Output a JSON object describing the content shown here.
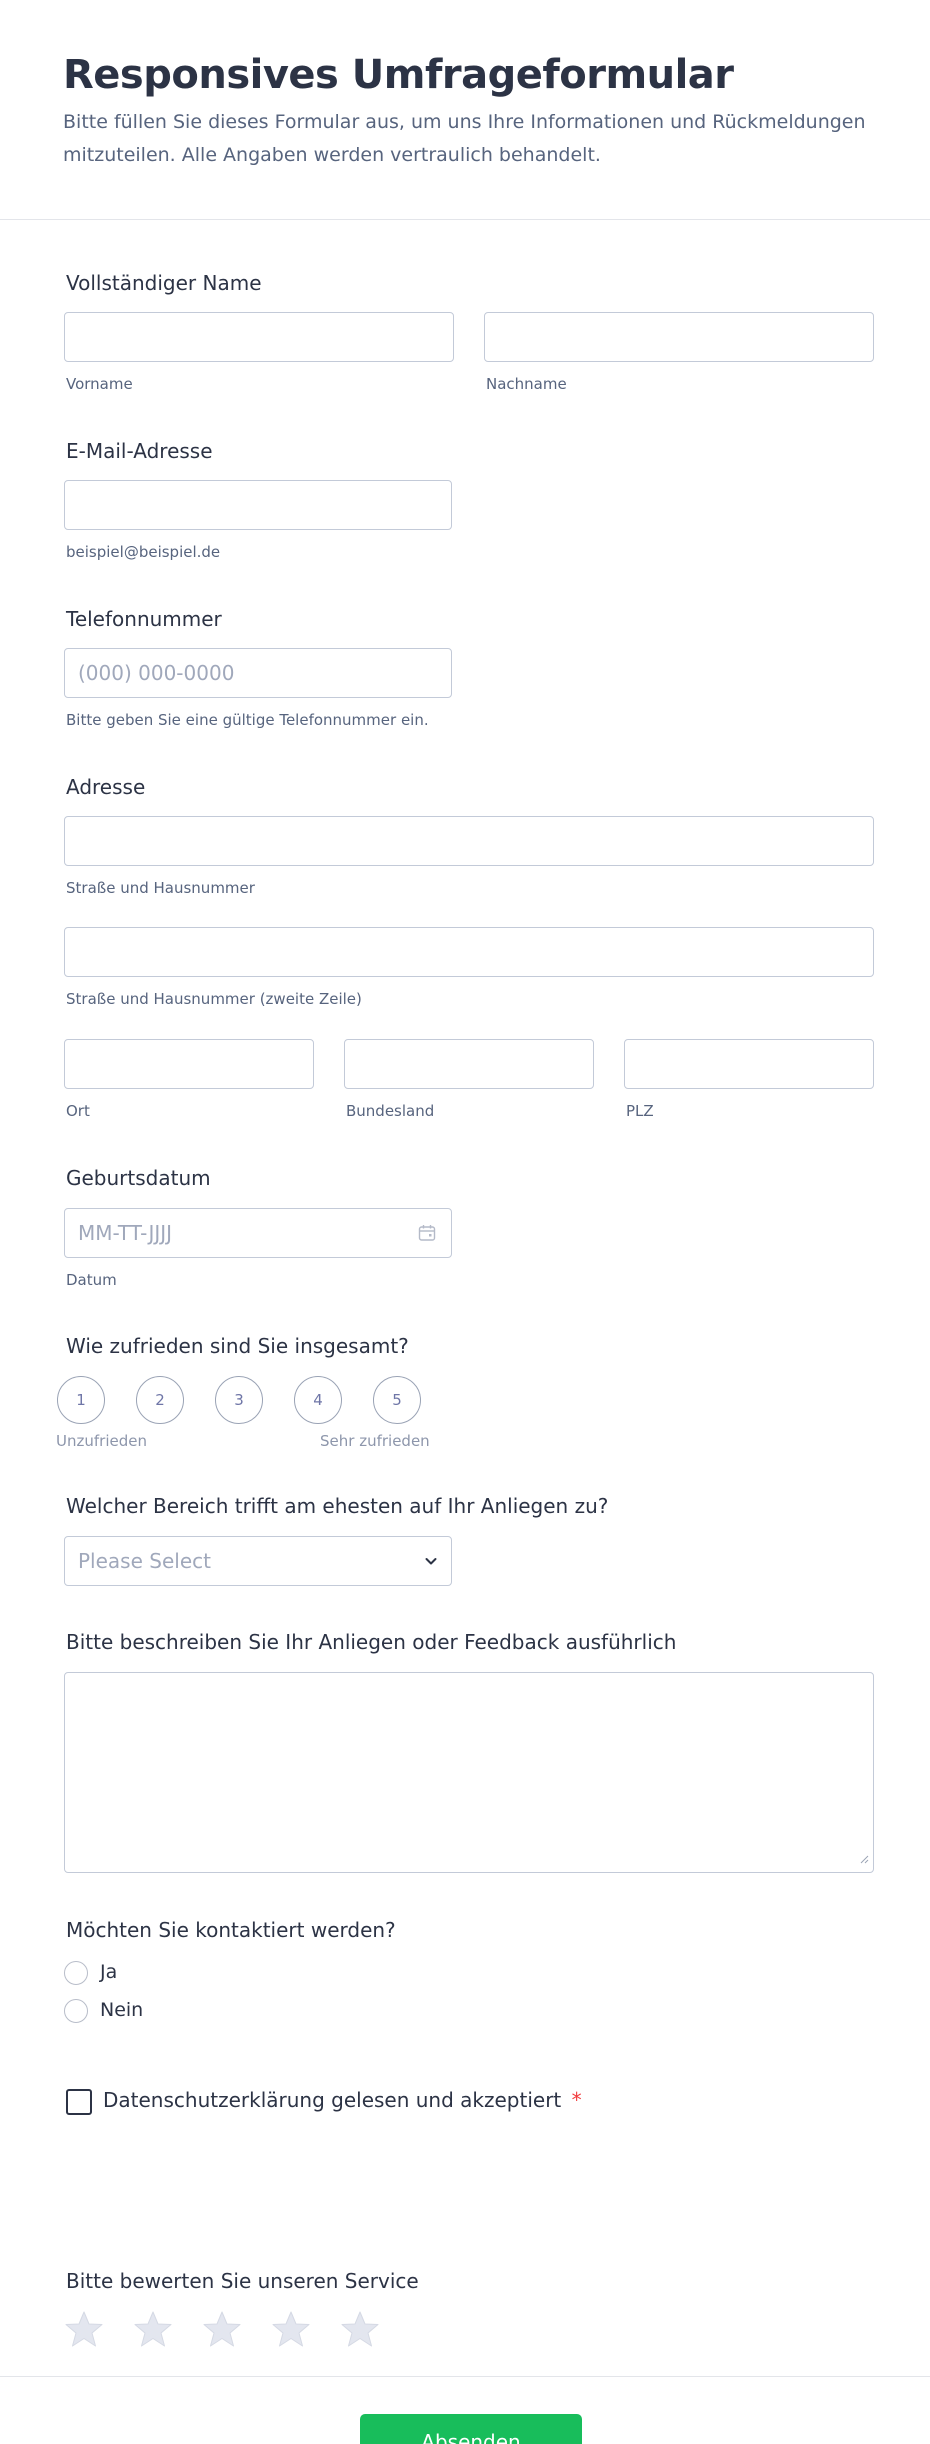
{
  "header": {
    "title": "Responsives Umfrageformular",
    "description": "Bitte füllen Sie dieses Formular aus, um uns Ihre Informationen und Rückmeldungen mitzuteilen. Alle Angaben werden vertraulich behandelt."
  },
  "name": {
    "label": "Vollständiger Name",
    "first_sub": "Vorname",
    "last_sub": "Nachname"
  },
  "email": {
    "label": "E-Mail-Adresse",
    "sub": "beispiel@beispiel.de"
  },
  "phone": {
    "label": "Telefonnummer",
    "placeholder": "(000) 000-0000",
    "sub": "Bitte geben Sie eine gültige Telefonnummer ein."
  },
  "address": {
    "label": "Adresse",
    "street_sub": "Straße und Hausnummer",
    "street2_sub": "Straße und Hausnummer (zweite Zeile)",
    "city_sub": "Ort",
    "state_sub": "Bundesland",
    "zip_sub": "PLZ"
  },
  "birthdate": {
    "label": "Geburtsdatum",
    "placeholder": "MM-TT-JJJJ",
    "sub": "Datum",
    "icon": "calendar-icon"
  },
  "satisfaction": {
    "label": "Wie zufrieden sind Sie insgesamt?",
    "options": [
      "1",
      "2",
      "3",
      "4",
      "5"
    ],
    "low_label": "Unzufrieden",
    "high_label": "Sehr zufrieden"
  },
  "category": {
    "label": "Welcher Bereich trifft am ehesten auf Ihr Anliegen zu?",
    "placeholder": "Please Select",
    "icon": "chevron-down-icon"
  },
  "feedback": {
    "label": "Bitte beschreiben Sie Ihr Anliegen oder Feedback ausführlich"
  },
  "contact": {
    "label": "Möchten Sie kontaktiert werden?",
    "options": [
      "Ja",
      "Nein"
    ]
  },
  "privacy": {
    "label": "Datenschutzerklärung gelesen und akzeptiert",
    "required_mark": "*"
  },
  "rating": {
    "label": "Bitte bewerten Sie unseren Service",
    "max": 5,
    "value": 0
  },
  "submit": {
    "label": "Absenden"
  },
  "colors": {
    "accent": "#18bd5b",
    "text": "#2c3345",
    "muted": "#57647e",
    "required": "#f23a3c",
    "star": "#e3e6ef"
  }
}
